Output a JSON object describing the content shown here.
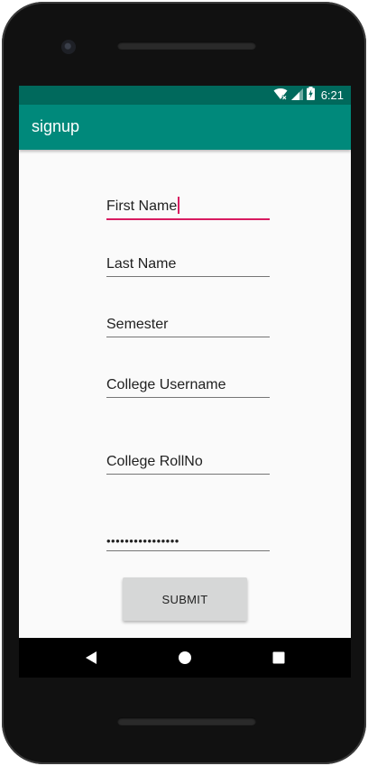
{
  "status_bar": {
    "time": "6:21",
    "icons": [
      "wifi-off-icon",
      "signal-icon",
      "battery-charging-icon"
    ]
  },
  "app_bar": {
    "title": "signup"
  },
  "form": {
    "fields": [
      {
        "name": "first-name-field",
        "text": "First Name",
        "focused": true
      },
      {
        "name": "last-name-field",
        "text": "Last Name"
      },
      {
        "name": "semester-field",
        "text": "Semester"
      },
      {
        "name": "college-username-field",
        "text": "College Username"
      },
      {
        "name": "college-rollno-field",
        "text": "College RollNo"
      },
      {
        "name": "password-field",
        "text": "••••••••••••••••"
      }
    ],
    "submit_label": "SUBMIT"
  },
  "navigation": {
    "buttons": [
      "back-icon",
      "home-icon",
      "recents-icon"
    ]
  },
  "colors": {
    "status_bar": "#00695c",
    "app_bar": "#00897b",
    "accent": "#d81b60",
    "background": "#fafafa",
    "button": "#d6d7d7"
  }
}
